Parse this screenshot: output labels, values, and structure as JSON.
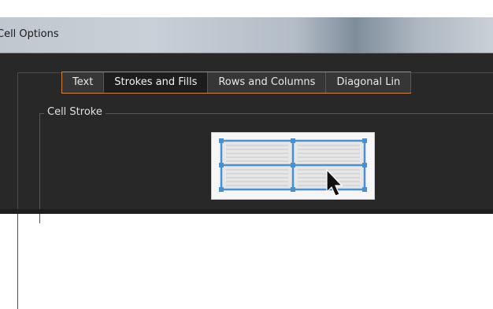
{
  "window": {
    "title": "Cell Options"
  },
  "tabs": [
    {
      "label": "Text",
      "active": false
    },
    {
      "label": "Strokes and Fills",
      "active": true
    },
    {
      "label": "Rows and Columns",
      "active": false
    },
    {
      "label": "Diagonal Lin",
      "active": false
    }
  ],
  "cell_stroke": {
    "label": "Cell Stroke"
  },
  "colors": {
    "accent_orange": "#d2803a",
    "stroke_blue": "#4a90d0",
    "panel_dark": "#282828"
  },
  "icons": {
    "cursor": "arrow-cursor-icon"
  }
}
